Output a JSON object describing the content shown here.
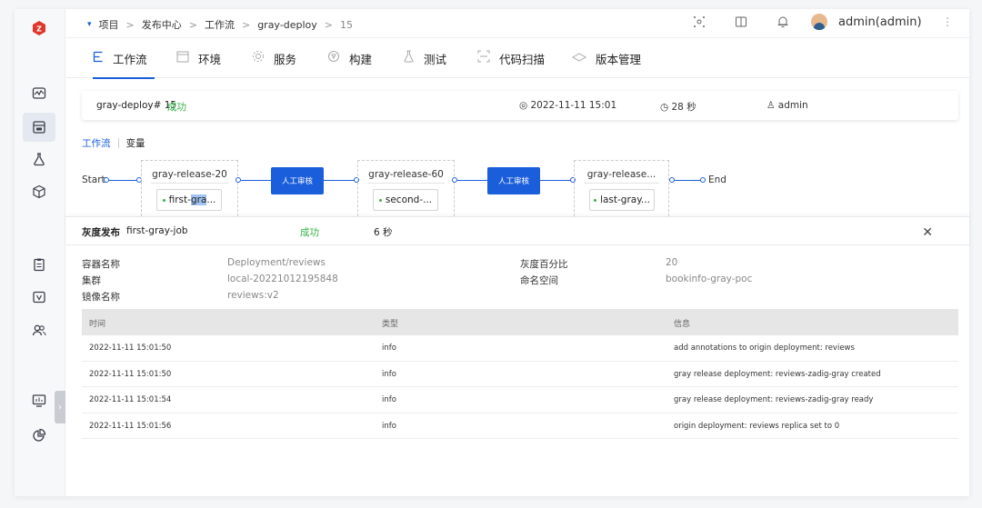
{
  "breadcrumb": {
    "dropdown": "▾",
    "items": [
      "项目",
      "发布中心",
      "工作流",
      "gray-deploy",
      "15"
    ],
    "separator": ">"
  },
  "header": {
    "username": "admin(admin)"
  },
  "tabs": [
    {
      "label": "工作流",
      "icon": "workflow-icon"
    },
    {
      "label": "环境",
      "icon": "environment-icon"
    },
    {
      "label": "服务",
      "icon": "service-icon"
    },
    {
      "label": "构建",
      "icon": "build-icon"
    },
    {
      "label": "测试",
      "icon": "test-icon"
    },
    {
      "label": "代码扫描",
      "icon": "code-scan-icon"
    },
    {
      "label": "版本管理",
      "icon": "version-icon"
    }
  ],
  "summary": {
    "name": "gray-deploy# 15",
    "status": "成功",
    "time": "2022-11-11 15:01",
    "duration": "28 秒",
    "user": "admin"
  },
  "subtabs": {
    "workflow": "工作流",
    "variables": "变量"
  },
  "flow": {
    "start": "Start",
    "end": "End",
    "stages": [
      {
        "name": "gray-release-20",
        "job_prefix": "first-",
        "job_highlight": "gra",
        "job_suffix": "..."
      },
      {
        "name": "gray-release-60",
        "job_prefix": "second-...",
        "job_highlight": "",
        "job_suffix": ""
      },
      {
        "name": "gray-release...",
        "job_prefix": "last-gray...",
        "job_highlight": "",
        "job_suffix": ""
      }
    ],
    "approvals": [
      "人工审核",
      "人工审核"
    ]
  },
  "detail": {
    "title": "灰度发布",
    "job": "first-gray-job",
    "status": "成功",
    "duration": "6 秒",
    "fields": {
      "container_label": "容器名称",
      "container_value": "Deployment/reviews",
      "cluster_label": "集群",
      "cluster_value": "local-20221012195848",
      "image_label": "镜像名称",
      "image_value": "reviews:v2",
      "percent_label": "灰度百分比",
      "percent_value": "20",
      "namespace_label": "命名空间",
      "namespace_value": "bookinfo-gray-poc"
    },
    "table": {
      "headers": [
        "时间",
        "类型",
        "信息"
      ],
      "rows": [
        [
          "2022-11-11 15:01:50",
          "info",
          "add annotations to origin deployment: reviews"
        ],
        [
          "2022-11-11 15:01:50",
          "info",
          "gray release deployment: reviews-zadig-gray created"
        ],
        [
          "2022-11-11 15:01:54",
          "info",
          "gray release deployment: reviews-zadig-gray ready"
        ],
        [
          "2022-11-11 15:01:56",
          "info",
          "origin deployment: reviews replica set to 0"
        ]
      ]
    }
  },
  "colors": {
    "accent": "#1b5edc",
    "success": "#33b24a",
    "brand": "#e0362c"
  }
}
